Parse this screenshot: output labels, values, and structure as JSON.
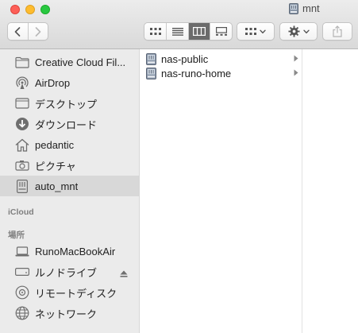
{
  "window": {
    "title": "mnt"
  },
  "toolbar": {
    "back_icon": "chevron-left-icon",
    "forward_icon": "chevron-right-icon",
    "views": [
      "icon-view",
      "list-view",
      "column-view",
      "gallery-view"
    ],
    "active_view": "column-view",
    "arrange_icon": "grid-icon",
    "action_icon": "gear-icon",
    "share_icon": "share-icon"
  },
  "sidebar": {
    "favorites": [
      {
        "label": "Creative Cloud Fil...",
        "icon": "folder-icon"
      },
      {
        "label": "AirDrop",
        "icon": "airdrop-icon"
      },
      {
        "label": "デスクトップ",
        "icon": "desktop-icon"
      },
      {
        "label": "ダウンロード",
        "icon": "download-icon"
      },
      {
        "label": "pedantic",
        "icon": "home-icon"
      },
      {
        "label": "ピクチャ",
        "icon": "camera-icon"
      },
      {
        "label": "auto_mnt",
        "icon": "network-drive-icon",
        "selected": true
      }
    ],
    "icloud_header": "iCloud",
    "locations_header": "場所",
    "locations": [
      {
        "label": "RunoMacBookAir",
        "icon": "laptop-icon"
      },
      {
        "label": "ルノドライブ",
        "icon": "drive-icon",
        "eject": true
      },
      {
        "label": "リモートディスク",
        "icon": "disc-icon"
      },
      {
        "label": "ネットワーク",
        "icon": "globe-icon"
      }
    ]
  },
  "column": {
    "items": [
      {
        "label": "nas-public",
        "icon": "network-drive-icon",
        "has_children": true
      },
      {
        "label": "nas-runo-home",
        "icon": "network-drive-icon",
        "has_children": true
      }
    ]
  },
  "colors": {
    "sidebar_bg": "#ebebeb",
    "selected_bg": "#d8d8d8",
    "close": "#fd5f57",
    "minimize": "#febc2e",
    "maximize": "#28c840"
  }
}
